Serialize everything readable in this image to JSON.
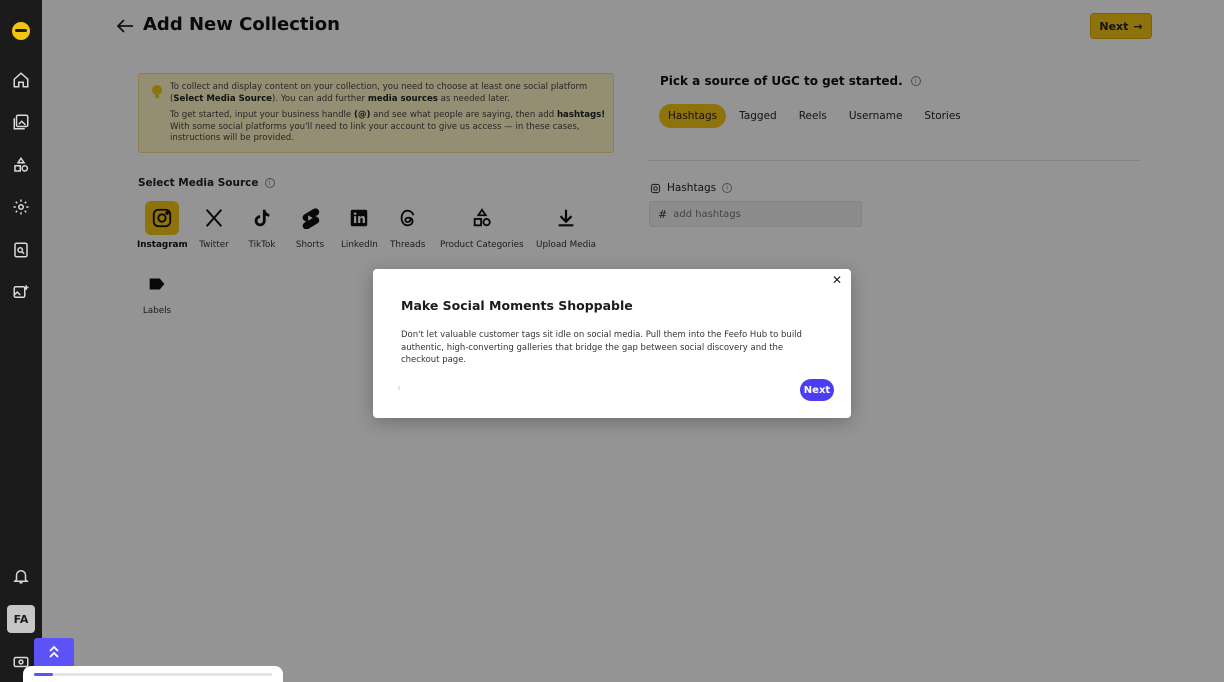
{
  "sidebar": {
    "items": [
      {
        "name": "home-icon"
      },
      {
        "name": "gallery-icon"
      },
      {
        "name": "shapes-icon"
      },
      {
        "name": "settings-icon"
      },
      {
        "name": "search-document-icon"
      },
      {
        "name": "add-image-icon"
      }
    ],
    "bottom": {
      "notifications": "bell-icon",
      "avatar_initials": "FA",
      "bottom_icon": "money-icon"
    }
  },
  "header": {
    "title": "Add New Collection",
    "next_label": "Next"
  },
  "info": {
    "p1_a": "To collect and display content on your collection, you need to choose at least one social platform (",
    "p1_b": "Select Media Source",
    "p1_c": "). You can add further ",
    "p1_d": "media sources",
    "p1_e": " as needed later.",
    "p2_a": "To get started, input your business handle ",
    "p2_b": "(@)",
    "p2_c": " and see what people are saying, then add ",
    "p2_d": "hashtags!",
    "p2_e": " With some social platforms you'll need to link your account to give us access — in these cases, instructions will be provided."
  },
  "media": {
    "label": "Select Media Source",
    "sources": [
      {
        "label": "Instagram",
        "icon": "instagram-icon",
        "selected": true
      },
      {
        "label": "Twitter",
        "icon": "x-icon"
      },
      {
        "label": "TikTok",
        "icon": "tiktok-icon"
      },
      {
        "label": "Shorts",
        "icon": "shorts-icon"
      },
      {
        "label": "LinkedIn",
        "icon": "linkedin-icon"
      },
      {
        "label": "Threads",
        "icon": "threads-icon"
      },
      {
        "label": "Product Categories",
        "icon": "shapes-icon"
      },
      {
        "label": "Upload Media",
        "icon": "download-icon"
      },
      {
        "label": "Labels",
        "icon": "label-icon"
      }
    ]
  },
  "ugc": {
    "title": "Pick a source of UGC to get started.",
    "tabs": [
      "Hashtags",
      "Tagged",
      "Reels",
      "Username",
      "Stories"
    ],
    "active_tab": "Hashtags",
    "hashtags_label": "Hashtags",
    "hashtag_placeholder": "add hashtags"
  },
  "modal": {
    "title": "Make Social Moments Shoppable",
    "body": "Don't let valuable customer tags sit idle on social media. Pull them into the Feefo Hub to build authentic, high-converting galleries that bridge the gap between social discovery and the checkout page.",
    "next_label": "Next"
  },
  "tour_progress": {
    "fraction": 0.08
  },
  "colors": {
    "accent": "#f4c617",
    "primary": "#4b3df2",
    "sidebar": "#1b1b1b"
  }
}
